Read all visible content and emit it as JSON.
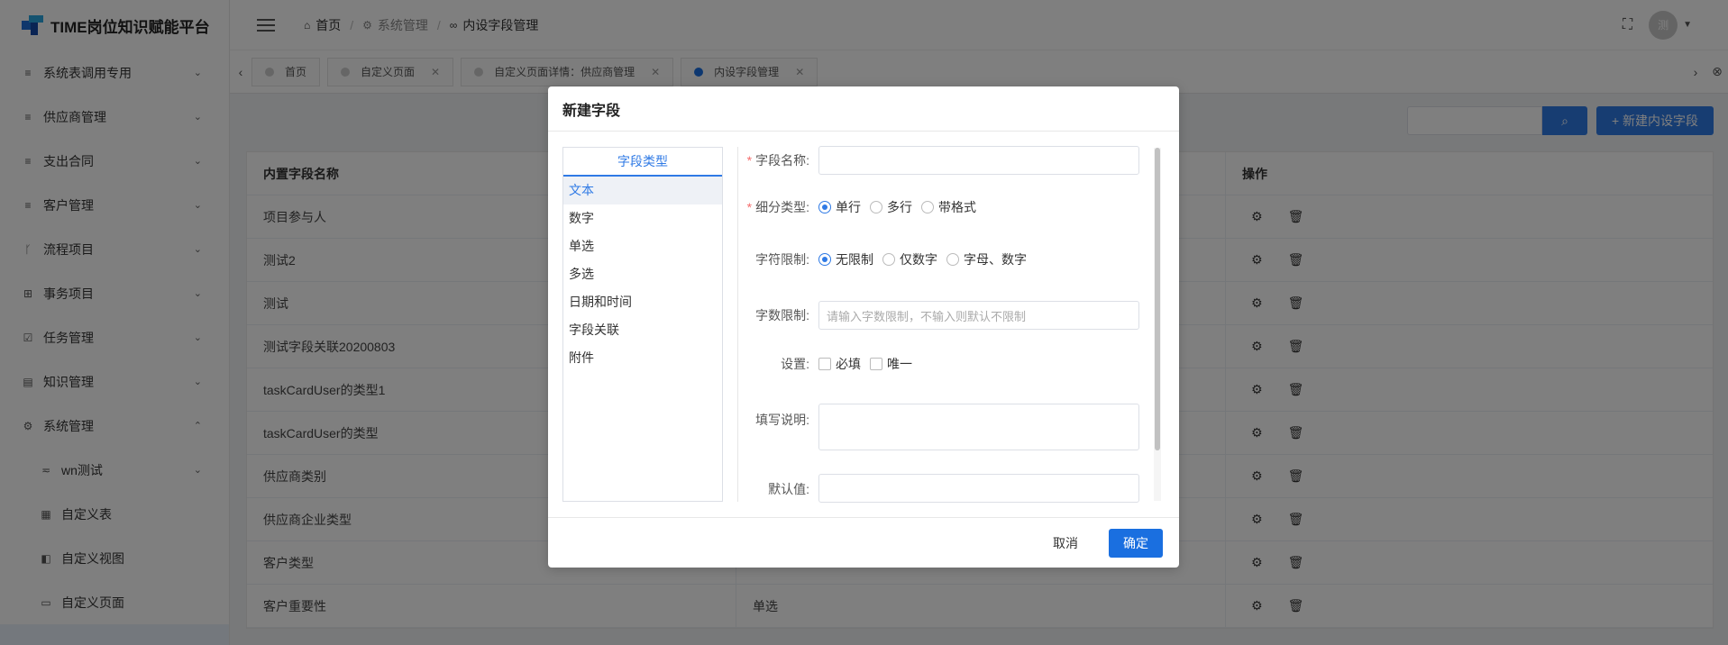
{
  "app": {
    "title": "TIME岗位知识赋能平台"
  },
  "sidebar": {
    "items": [
      {
        "label": "系统表调用专用",
        "icon": "list-icon"
      },
      {
        "label": "供应商管理",
        "icon": "list-icon"
      },
      {
        "label": "支出合同",
        "icon": "list-icon"
      },
      {
        "label": "客户管理",
        "icon": "list-icon"
      },
      {
        "label": "流程项目",
        "icon": "branch-icon"
      },
      {
        "label": "事务项目",
        "icon": "grid-icon"
      },
      {
        "label": "任务管理",
        "icon": "checkbox-icon"
      },
      {
        "label": "知识管理",
        "icon": "book-icon"
      },
      {
        "label": "系统管理",
        "icon": "gear-icon"
      }
    ],
    "sub_items": [
      {
        "label": "wn测试",
        "icon": "filter-icon"
      },
      {
        "label": "自定义表",
        "icon": "table-icon"
      },
      {
        "label": "自定义视图",
        "icon": "layers-icon"
      },
      {
        "label": "自定义页面",
        "icon": "page-icon"
      }
    ]
  },
  "header": {
    "breadcrumb": [
      "首页",
      "系统管理",
      "内设字段管理"
    ],
    "avatar_text": "测"
  },
  "tabs": [
    {
      "label": "首页",
      "closable": false,
      "active": false
    },
    {
      "label": "自定义页面",
      "closable": true,
      "active": false
    },
    {
      "label": "自定义页面详情：供应商管理",
      "closable": true,
      "active": false
    },
    {
      "label": "内设字段管理",
      "closable": true,
      "active": true
    }
  ],
  "toolbar": {
    "new_label": "+ 新建内设字段"
  },
  "table": {
    "headers": [
      "内置字段名称",
      "",
      "操作"
    ],
    "rows": [
      [
        "项目参与人",
        ""
      ],
      [
        "测试2",
        ""
      ],
      [
        "测试",
        ""
      ],
      [
        "测试字段关联20200803",
        ""
      ],
      [
        "taskCardUser的类型1",
        ""
      ],
      [
        "taskCardUser的类型",
        ""
      ],
      [
        "供应商类别",
        ""
      ],
      [
        "供应商企业类型",
        ""
      ],
      [
        "客户类型",
        ""
      ],
      [
        "客户重要性",
        "单选"
      ]
    ]
  },
  "modal": {
    "title": "新建字段",
    "type_panel_header": "字段类型",
    "types": [
      "文本",
      "数字",
      "单选",
      "多选",
      "日期和时间",
      "字段关联",
      "附件"
    ],
    "selected_type": "文本",
    "fields": {
      "name_label": "字段名称:",
      "subtype_label": "细分类型:",
      "subtype_options": [
        "单行",
        "多行",
        "带格式"
      ],
      "subtype_selected": "单行",
      "charlimit_label": "字符限制:",
      "charlimit_options": [
        "无限制",
        "仅数字",
        "字母、数字"
      ],
      "charlimit_selected": "无限制",
      "length_label": "字数限制:",
      "length_placeholder": "请输入字数限制，不输入则默认不限制",
      "settings_label": "设置:",
      "settings_options": [
        "必填",
        "唯一"
      ],
      "description_label": "填写说明:",
      "default_label": "默认值:"
    },
    "cancel_label": "取消",
    "ok_label": "确定"
  }
}
